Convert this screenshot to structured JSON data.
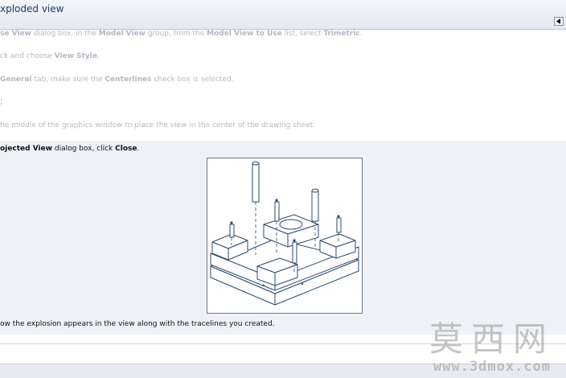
{
  "title": "xploded view",
  "steps": [
    {
      "parts": [
        "se View",
        " dialog box, in the ",
        "Model View",
        " group, from the ",
        "Model View to Use",
        " list, select ",
        "Trimetric",
        "."
      ]
    },
    {
      "parts": [
        "ck and choose ",
        "View Style",
        "."
      ]
    },
    {
      "parts": [
        "General",
        " tab, make sure the ",
        "Centerlines",
        " check box is selected."
      ]
    },
    {
      "parts": [
        "he middle of the graphics window to place the view in the center of the drawing sheet."
      ]
    },
    {
      "parts": [
        "ojected View",
        " dialog box, click ",
        "Close",
        "."
      ]
    },
    {
      "parts": [
        "ow the explosion appears in the view along with the tracelines you created."
      ]
    }
  ],
  "watermark": {
    "main": "莫西网",
    "sub": "www.3dmox.com"
  },
  "colors": {
    "title_text": "#1e3a5c",
    "inactive_text": "#b3b9c2",
    "active_bg": "#eef1f6",
    "line_art": "#2c4a6e"
  },
  "icons": {
    "collapse": "triangle-left-icon"
  }
}
